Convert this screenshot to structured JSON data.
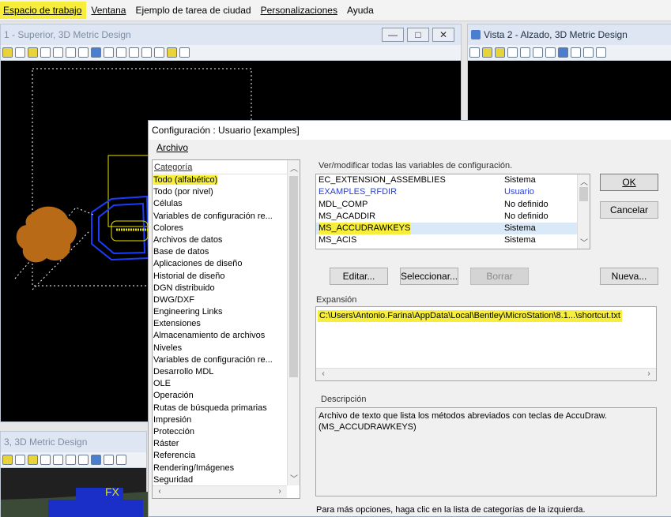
{
  "menubar": {
    "items": [
      "Espacio de trabajo",
      "Ventana",
      "Ejemplo de tarea de ciudad",
      "Personalizaciones",
      "Ayuda"
    ]
  },
  "views": {
    "view1_title": "1 - Superior, 3D Metric Design",
    "view2_title": "Vista 2 - Alzado, 3D Metric Design",
    "view3_title": "3, 3D Metric Design",
    "view3_text": "FX"
  },
  "dialog": {
    "title": "Configuración : Usuario [examples]",
    "menu_archivo": "Archivo",
    "category_header": "Categoría",
    "categories": [
      "Todo (alfabético)",
      "Todo (por nivel)",
      "Células",
      "Variables de configuración re...",
      "Colores",
      "Archivos de datos",
      "Base de datos",
      "Aplicaciones de diseño",
      "Historial de diseño",
      "DGN distribuido",
      "DWG/DXF",
      "Engineering Links",
      "Extensiones",
      "Almacenamiento de archivos",
      "Niveles",
      "Variables de configuración re...",
      "Desarrollo MDL",
      "OLE",
      "Operación",
      "Rutas de búsqueda primarias",
      "Impresión",
      "Protección",
      "Ráster",
      "Referencia",
      "Rendering/Imágenes",
      "Seguridad"
    ],
    "vars_label": "Ver/modificar todas las variables de configuración.",
    "variables": [
      {
        "name": "EC_EXTENSION_ASSEMBLIES",
        "level": "Sistema"
      },
      {
        "name": "EXAMPLES_RFDIR",
        "level": "Usuario"
      },
      {
        "name": "MDL_COMP",
        "level": "No definido"
      },
      {
        "name": "MS_ACADDIR",
        "level": "No definido"
      },
      {
        "name": "MS_ACCUDRAWKEYS",
        "level": "Sistema"
      },
      {
        "name": "MS_ACIS",
        "level": "Sistema"
      }
    ],
    "buttons": {
      "ok": "OK",
      "cancel": "Cancelar",
      "edit": "Editar...",
      "select": "Seleccionar...",
      "delete": "Borrar",
      "new": "Nueva..."
    },
    "expansion_label": "Expansión",
    "expansion_value": "C:\\Users\\Antonio.Farina\\AppData\\Local\\Bentley\\MicroStation\\8.1...\\shortcut.txt",
    "description_label": "Descripción",
    "description_text": "Archivo de texto que lista los métodos abreviados con teclas de AccuDraw. (MS_ACCUDRAWKEYS)",
    "footer": "Para más opciones, haga clic en la lista de categorías de la izquierda."
  },
  "colors": {
    "highlight": "#f6ee3a",
    "user_var": "#2a3fd6",
    "canvas": "#000000",
    "blob": "#b86a17",
    "cad_blue": "#1a3cff",
    "cad_yellow": "#e7e200"
  }
}
